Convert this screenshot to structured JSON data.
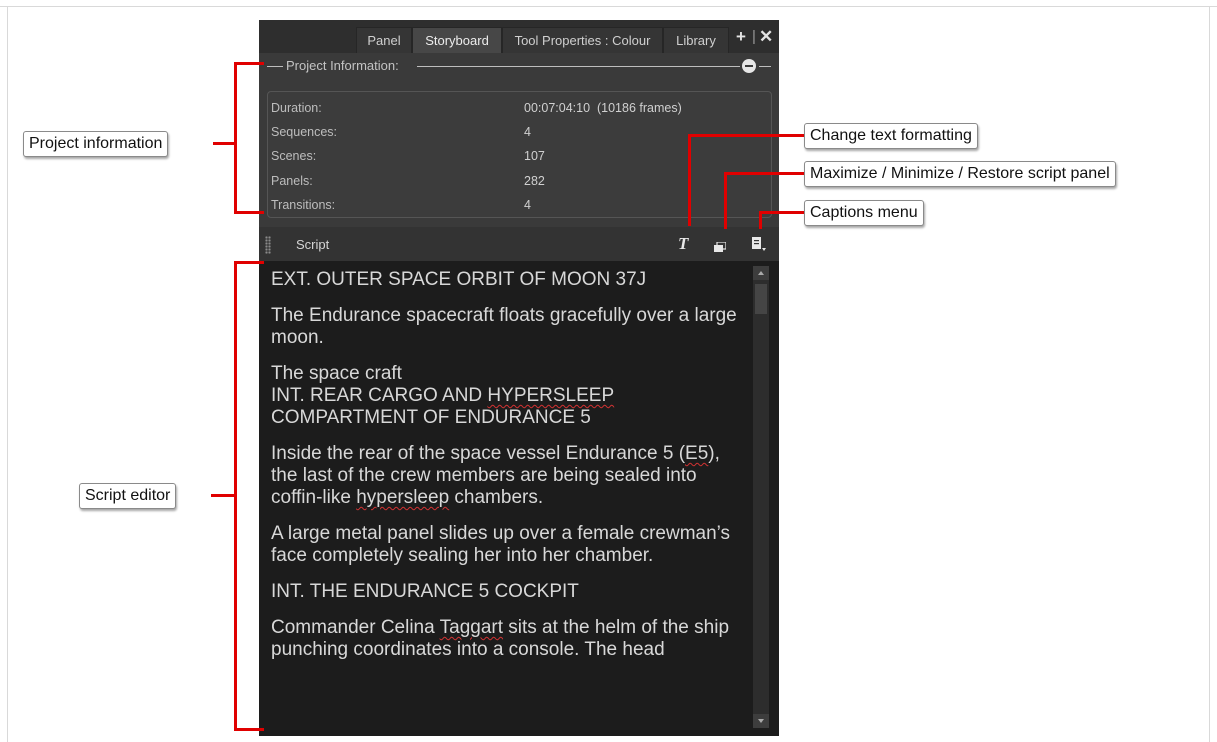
{
  "tabs": [
    {
      "label": "Panel",
      "active": false
    },
    {
      "label": "Storyboard",
      "active": true
    },
    {
      "label": "Tool Properties : Colour",
      "active": false
    },
    {
      "label": "Library",
      "active": false
    }
  ],
  "tab_actions": {
    "add_icon": "plus-icon",
    "close_icon": "close-icon"
  },
  "project_info": {
    "header": "Project Information:",
    "rows": [
      {
        "label": "Duration:",
        "value": "00:07:04:10  (10186 frames)"
      },
      {
        "label": "Sequences:",
        "value": "4"
      },
      {
        "label": "Scenes:",
        "value": "107"
      },
      {
        "label": "Panels:",
        "value": "282"
      },
      {
        "label": "Transitions:",
        "value": "4"
      }
    ]
  },
  "script_toolbar": {
    "label": "Script",
    "icons": [
      "text-format-icon",
      "maximize-restore-icon",
      "captions-menu-icon"
    ]
  },
  "script_text": {
    "p1": "EXT. OUTER SPACE ORBIT OF MOON 37J",
    "p2": "The Endurance spacecraft floats gracefully over a large moon.",
    "p3_a": "The space craft",
    "p3_b1": "INT. REAR CARGO AND ",
    "p3_b2": "HYPERSLEEP",
    "p3_c": "COMPARTMENT OF ENDURANCE 5",
    "p4_a": "Inside the rear of the space vessel Endurance 5 (",
    "p4_b": "E5",
    "p4_c": "), the last of the crew members are being sealed into coffin-like ",
    "p4_d": "hypersleep",
    "p4_e": " chambers.",
    "p5": "A large metal panel slides up over a female crewman’s face completely sealing her into her chamber.",
    "p6": "INT. THE ENDURANCE 5 COCKPIT",
    "p7_a": "Commander Celina ",
    "p7_b": "Taggart",
    "p7_c": " sits at the helm of the ship punching coordinates into a console. The head"
  },
  "callouts": {
    "project_information": "Project information",
    "script_editor": "Script editor",
    "change_text_formatting": "Change text formatting",
    "maximize_minimize_restore": "Maximize / Minimize / Restore script panel",
    "captions_menu": "Captions menu"
  },
  "colors": {
    "callout_line": "#e00000",
    "panel_bg": "#3a3a3a",
    "editor_bg": "#1c1c1c"
  }
}
